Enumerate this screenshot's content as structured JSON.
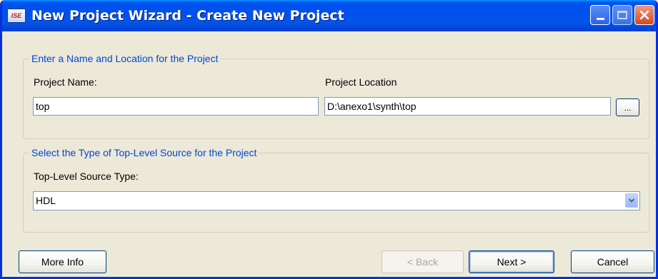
{
  "window": {
    "title": "New Project Wizard - Create New Project",
    "icon_text": "ISE"
  },
  "group_name_location": {
    "legend": "Enter a Name and Location for the Project",
    "project_name_label": "Project Name:",
    "project_name_value": "top",
    "project_location_label": "Project Location",
    "project_location_value": "D:\\anexo1\\synth\\top",
    "browse_label": "..."
  },
  "group_source_type": {
    "legend": "Select the Type of Top-Level Source for the Project",
    "source_type_label": "Top-Level Source Type:",
    "source_type_value": "HDL"
  },
  "buttons": {
    "more_info": "More Info",
    "back": "< Back",
    "next": "Next >",
    "cancel": "Cancel"
  },
  "colors": {
    "titlebar": "#0053ee",
    "legend_text": "#0046d5",
    "dialog_bg": "#ece9d8"
  }
}
